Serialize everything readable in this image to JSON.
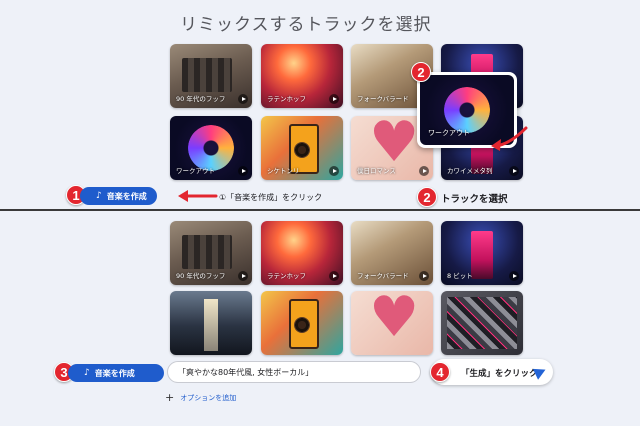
{
  "top": {
    "title": "リミックスするトラックを選択",
    "tiles": [
      {
        "label": "90 年代のフッフ",
        "art": "retro"
      },
      {
        "label": "ラテンホッフ",
        "art": "crowd"
      },
      {
        "label": "フォークバラード",
        "art": "folk"
      },
      {
        "label": "",
        "art": "arcade"
      },
      {
        "label": "ワークアウト",
        "art": "swirl"
      },
      {
        "label": "シケトンリ",
        "art": "speaker"
      },
      {
        "label": "僕日ロマンス",
        "art": "heart"
      },
      {
        "label": "カワイメメタ列",
        "art": "arcade"
      }
    ],
    "highlight": {
      "label": "ワークアウト"
    },
    "steps": [
      {
        "num": "1",
        "button_label": "音楽を作成",
        "hint": "①「音楽を作成」をクリック"
      },
      {
        "num": "2",
        "text": "トラックを選択"
      }
    ]
  },
  "bottom": {
    "tiles": [
      {
        "label": "90 年代のフッフ",
        "art": "retro"
      },
      {
        "label": "ラテンホッフ",
        "art": "crowd"
      },
      {
        "label": "フォークバラード",
        "art": "folk"
      },
      {
        "label": "8 ビット",
        "art": "arcade"
      },
      {
        "label": "",
        "art": "alley"
      },
      {
        "label": "",
        "art": "speaker"
      },
      {
        "label": "",
        "art": "heart"
      },
      {
        "label": "",
        "art": "shards"
      }
    ],
    "steps": [
      {
        "num": "3",
        "button_label": "音楽を作成"
      },
      {
        "num": "4",
        "text": "「生成」をクリック"
      }
    ],
    "prompt_value": "「爽やかな80年代風, 女性ボーカル」",
    "add_option": "オプションを追加"
  },
  "colors": {
    "accent": "#1f5ccc",
    "badge": "#e3262f",
    "background": "#eef1f8"
  },
  "icons": {
    "music": "music-note-icon",
    "send": "send-icon",
    "play": "play-icon",
    "plus": "plus-icon"
  }
}
